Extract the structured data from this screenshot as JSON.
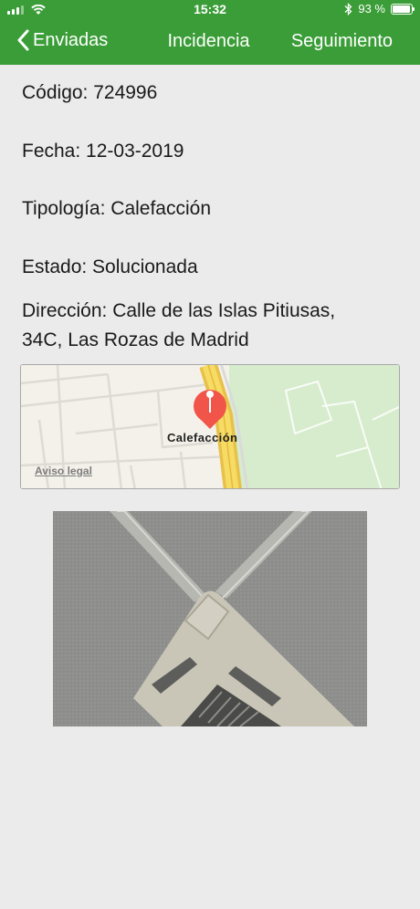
{
  "status_bar": {
    "time": "15:32",
    "battery_text": "93 %",
    "battery_level": 0.93
  },
  "nav": {
    "back_label": "Enviadas",
    "title": "Incidencia",
    "follow_label": "Seguimiento"
  },
  "details": {
    "codigo": "Código: 724996",
    "fecha": "Fecha: 12-03-2019",
    "tipologia": "Tipología: Calefacción",
    "estado": "Estado: Solucionada",
    "direccion_line1": "Dirección: Calle de las Islas Pitiusas,",
    "direccion_line2": "34C, Las Rozas de Madrid"
  },
  "map": {
    "pin_label": "Calefacción",
    "legal_link": "Aviso legal"
  },
  "colors": {
    "header_bg": "#3a9d37",
    "pin": "#f1554a"
  }
}
